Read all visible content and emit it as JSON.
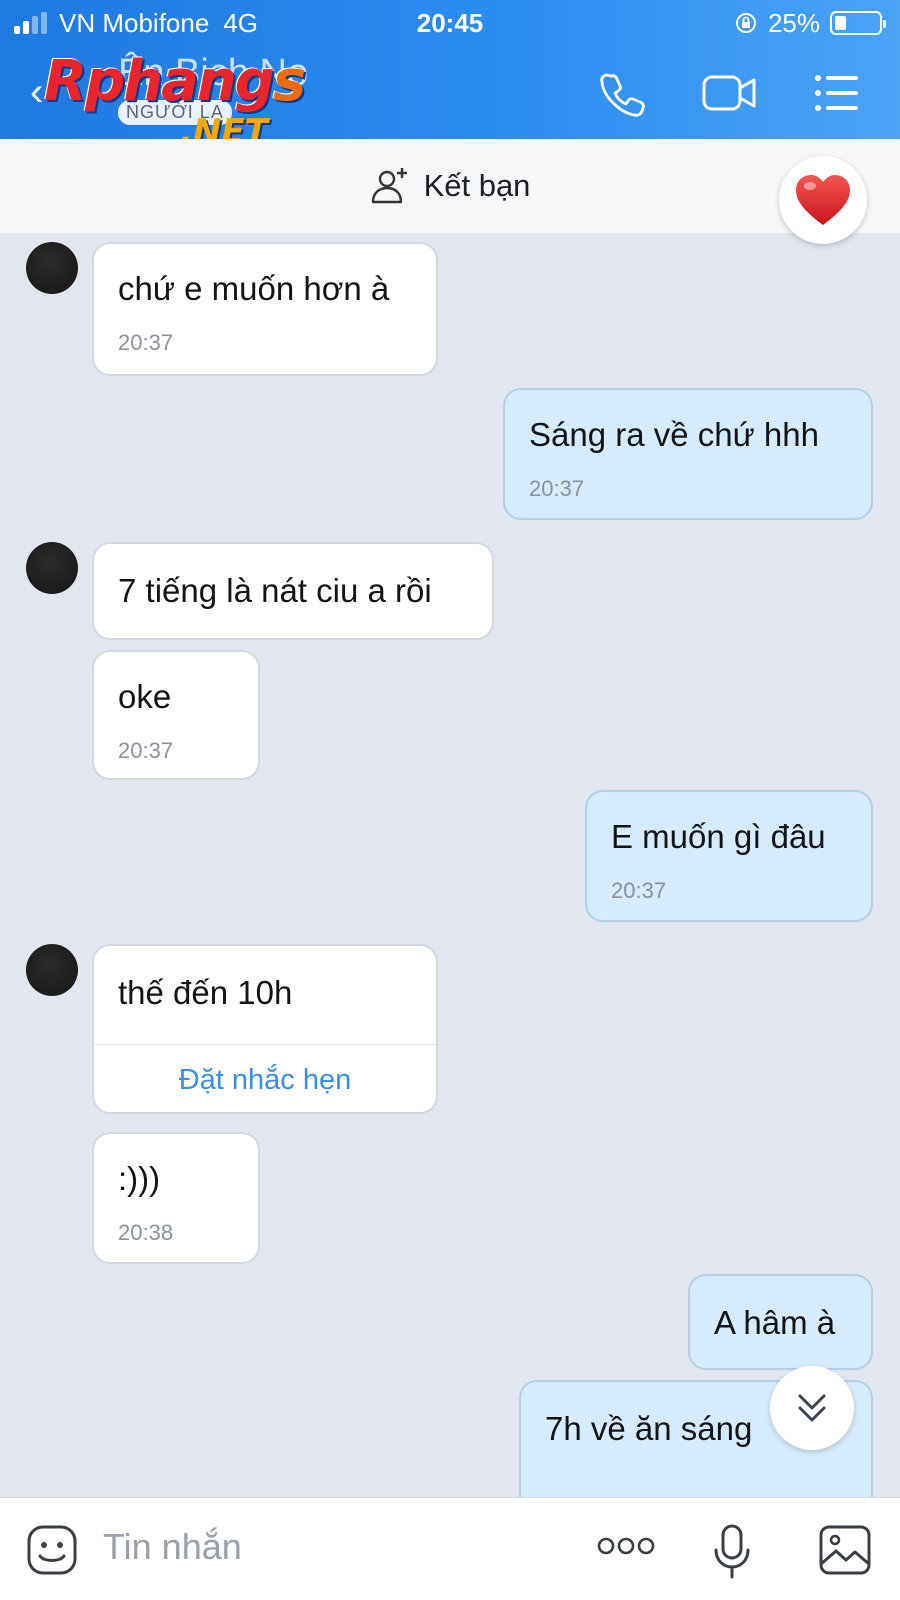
{
  "status_bar": {
    "carrier": "VN Mobifone",
    "network": "4G",
    "time": "20:45",
    "battery": "25%",
    "battery_level": 0.25
  },
  "header": {
    "contact_name": "Ên Bịch Nọ",
    "stranger_tag": "NGƯỜI LẠ",
    "watermark_main": "Rphang",
    "watermark_s": "s",
    "watermark_net": ".NET",
    "icons": [
      "back-arrow-icon",
      "phone-icon",
      "video-camera-icon",
      "menu-list-icon"
    ]
  },
  "friend_bar": {
    "label": "Kết bạn",
    "icon": "add-friend-icon"
  },
  "messages": [
    {
      "side": "in",
      "text": "chứ e muốn hơn à",
      "time": "20:37"
    },
    {
      "side": "out",
      "text": "Sáng ra về chứ hhh",
      "time": "20:37"
    },
    {
      "side": "in",
      "text": "7 tiếng là nát ciu a rồi",
      "time": ""
    },
    {
      "side": "in",
      "text": "oke",
      "time": "20:37"
    },
    {
      "side": "out",
      "text": "E muốn gì đâu",
      "time": "20:37"
    },
    {
      "side": "in",
      "text": "thế đến 10h",
      "action": "Đặt nhắc hẹn"
    },
    {
      "side": "in",
      "text": ":)))",
      "time": "20:38"
    },
    {
      "side": "out",
      "text": "A hâm à",
      "time": ""
    },
    {
      "side": "out",
      "text": "7h về ăn sáng",
      "time": ""
    }
  ],
  "input_bar": {
    "placeholder": "Tin nhắn",
    "icons": [
      "sticker-icon",
      "more-dots-icon",
      "microphone-icon",
      "image-icon"
    ]
  },
  "colors": {
    "header_blue": "#2b8cf0",
    "outgoing_bubble": "#d6ebfb",
    "incoming_bubble": "#ffffff",
    "chat_background": "#e2e7ef",
    "link_blue": "#3b8ee6",
    "heart_red": "#e0242c"
  }
}
